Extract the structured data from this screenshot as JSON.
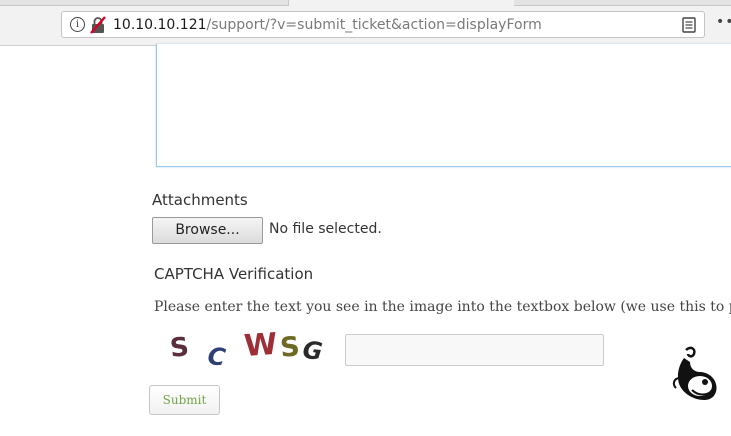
{
  "browser": {
    "url_host": "10.10.10.121",
    "url_path": "/support/?v=submit_ticket&action=displayForm",
    "info_icon": "info-icon",
    "security_icon": "insecure-connection-icon",
    "reader_icon": "reader-view-icon",
    "menu_icon": "more-actions-icon",
    "info_glyph": "i",
    "menu_glyph": "•••"
  },
  "form": {
    "attachments_label": "Attachments",
    "browse_button": "Browse...",
    "file_status": "No file selected.",
    "captcha_heading": "CAPTCHA Verification",
    "captcha_instructions": "Please enter the text you see in the image into the textbox below (we use this to prevent automated submissions).",
    "captcha_chars": [
      "S",
      "C",
      "W",
      "S",
      "G"
    ],
    "captcha_colors": [
      "#5a2e3c",
      "#2e3f73",
      "#9e2f37",
      "#6e6a24",
      "#2a2a2a"
    ],
    "captcha_input_value": "",
    "captcha_input_placeholder": "",
    "submit_button": "Submit",
    "accent_submit_text": "#74a448",
    "focus_border": "#9ac7e8"
  }
}
